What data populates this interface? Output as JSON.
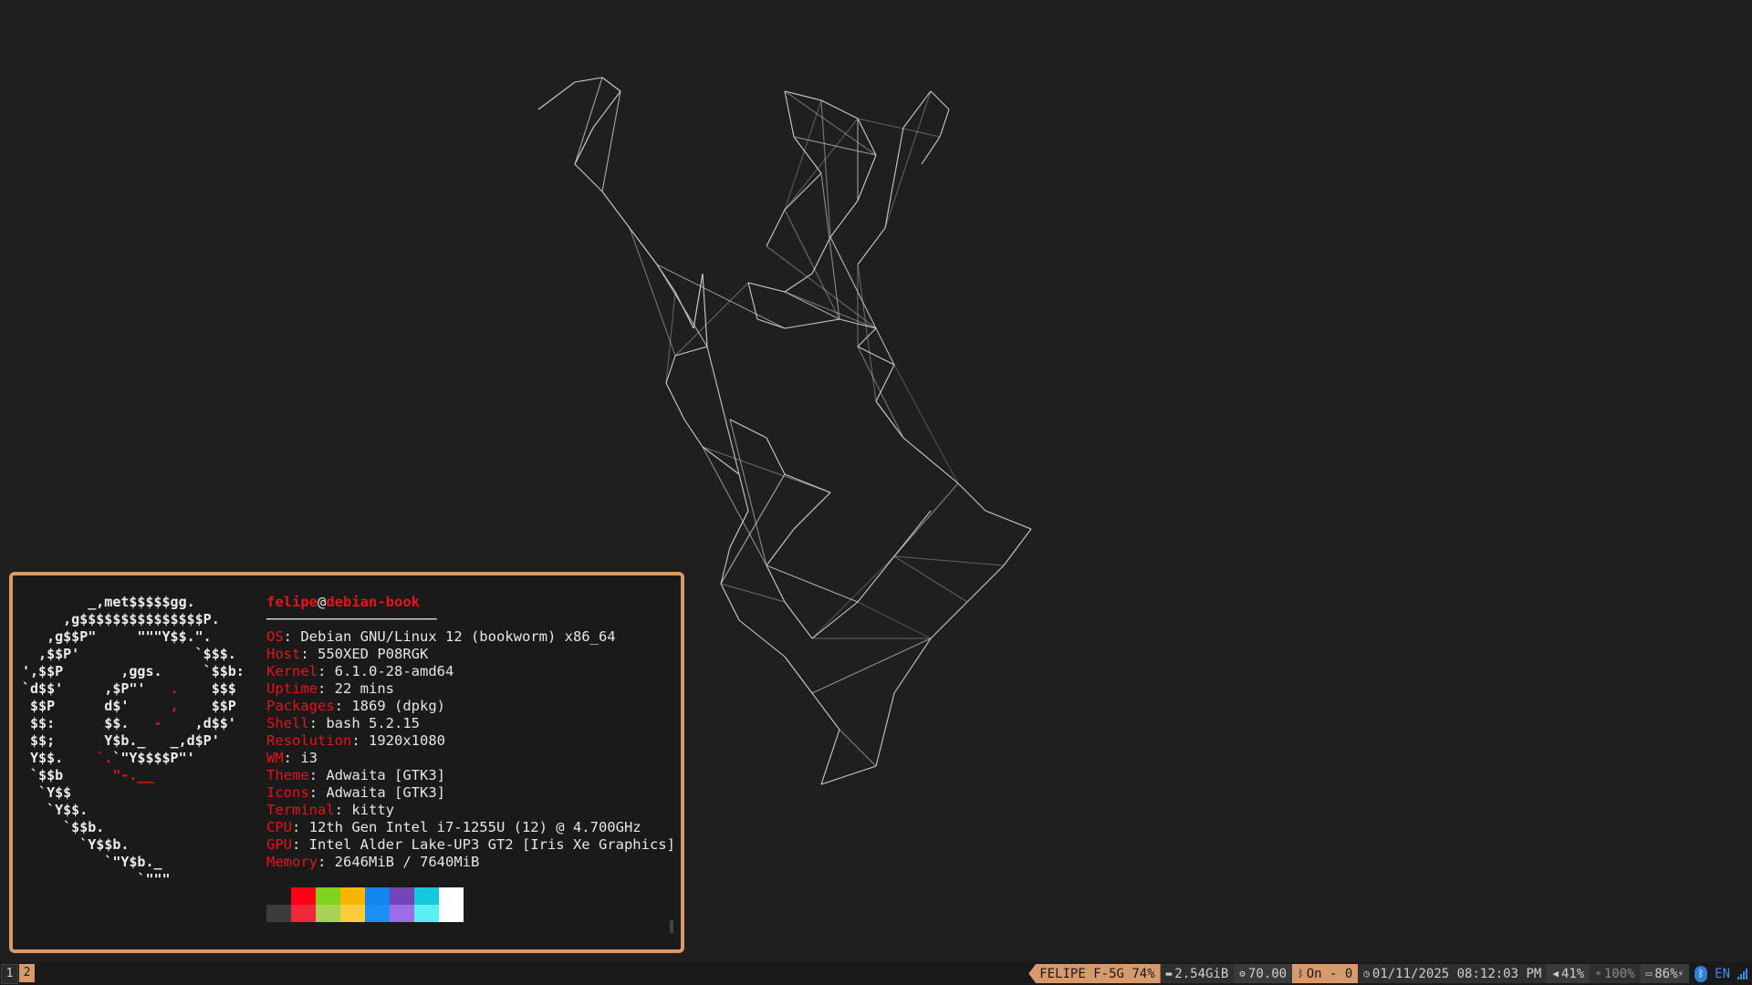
{
  "terminal": {
    "user": "felipe",
    "at": "@",
    "host": "debian-book",
    "separator": "────────────────────",
    "info": [
      {
        "key": "OS",
        "value": "Debian GNU/Linux 12 (bookworm) x86_64"
      },
      {
        "key": "Host",
        "value": "550XED P08RGK"
      },
      {
        "key": "Kernel",
        "value": "6.1.0-28-amd64"
      },
      {
        "key": "Uptime",
        "value": "22 mins"
      },
      {
        "key": "Packages",
        "value": "1869 (dpkg)"
      },
      {
        "key": "Shell",
        "value": "bash 5.2.15"
      },
      {
        "key": "Resolution",
        "value": "1920x1080"
      },
      {
        "key": "WM",
        "value": "i3"
      },
      {
        "key": "Theme",
        "value": "Adwaita [GTK3]"
      },
      {
        "key": "Icons",
        "value": "Adwaita [GTK3]"
      },
      {
        "key": "Terminal",
        "value": "kitty"
      },
      {
        "key": "CPU",
        "value": "12th Gen Intel i7-1255U (12) @ 4.700GHz"
      },
      {
        "key": "GPU",
        "value": "Intel Alder Lake-UP3 GT2 [Iris Xe Graphics]"
      },
      {
        "key": "Memory",
        "value": "2646MiB / 7640MiB"
      }
    ],
    "palette_top": [
      "#1a1a1a",
      "#ff0014",
      "#7fd31c",
      "#f7b500",
      "#1486f2",
      "#7346b8",
      "#16c8dd",
      "#ffffff"
    ],
    "palette_bottom": [
      "#3c3c3c",
      "#f0283c",
      "#a8d254",
      "#fdcc3c",
      "#1c8ff5",
      "#9c6de8",
      "#5af0f2",
      "#ffffff"
    ],
    "colors": {
      "key": "#e8131b",
      "accent": "#d79a6c"
    }
  },
  "bar": {
    "workspaces": [
      "1",
      "2"
    ],
    "wifi": "FELIPE F-5G 74%",
    "disk": "2.54GiB",
    "temp": "70.00",
    "bluetooth": "On - 0",
    "datetime": "01/11/2025 08:12:03 PM",
    "volume": "41%",
    "brightness": "100%",
    "battery": "86%",
    "layout": "EN",
    "icons": [
      "disk-icon",
      "thermometer-icon",
      "bluetooth-icon",
      "clock-icon",
      "volume-icon",
      "brightness-icon",
      "battery-icon",
      "bluetooth-tray-icon",
      "signal-icon"
    ]
  }
}
